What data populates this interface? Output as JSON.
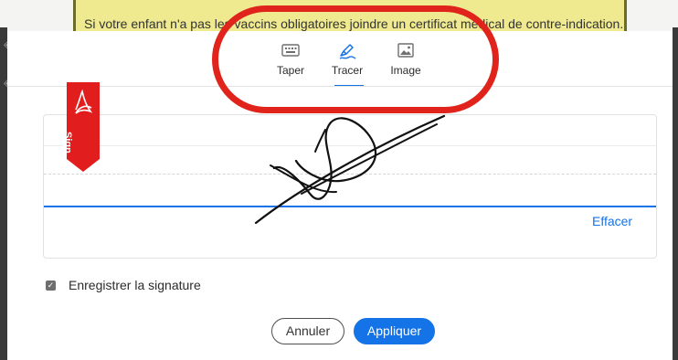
{
  "background": {
    "banner_text": "Si votre enfant n'a pas les vaccins obligatoires joindre un certificat médical de contre-indication."
  },
  "tabs": {
    "items": [
      {
        "label": "Taper",
        "icon": "keyboard-icon"
      },
      {
        "label": "Tracer",
        "icon": "pen-draw-icon",
        "active": true
      },
      {
        "label": "Image",
        "icon": "image-icon"
      }
    ]
  },
  "signature": {
    "ribbon_label": "Sign",
    "clear_label": "Effacer"
  },
  "options": {
    "save_signature_label": "Enregistrer la signature",
    "save_signature_checked": true
  },
  "actions": {
    "cancel_label": "Annuler",
    "apply_label": "Appliquer"
  },
  "colors": {
    "accent": "#1473e6",
    "annotation": "#e0241b",
    "ribbon": "#e21d1d"
  }
}
